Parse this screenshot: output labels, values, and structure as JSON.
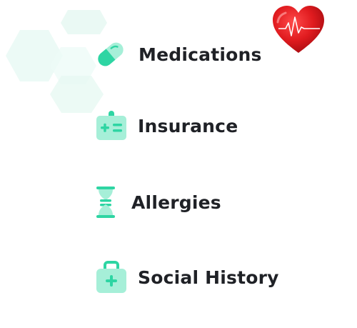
{
  "accent_color": "#2ed5a3",
  "accent_light": "#a6efd8",
  "heart_color": "#d4141a",
  "menu": {
    "items": [
      {
        "label": "Medications",
        "icon": "pill-icon"
      },
      {
        "label": "Insurance",
        "icon": "insurance-card-icon"
      },
      {
        "label": "Allergies",
        "icon": "dna-icon"
      },
      {
        "label": "Social History",
        "icon": "medical-bag-icon"
      }
    ]
  },
  "decoration": {
    "heart_icon": "heart-pulse-icon",
    "background": "hexagon-pattern"
  }
}
